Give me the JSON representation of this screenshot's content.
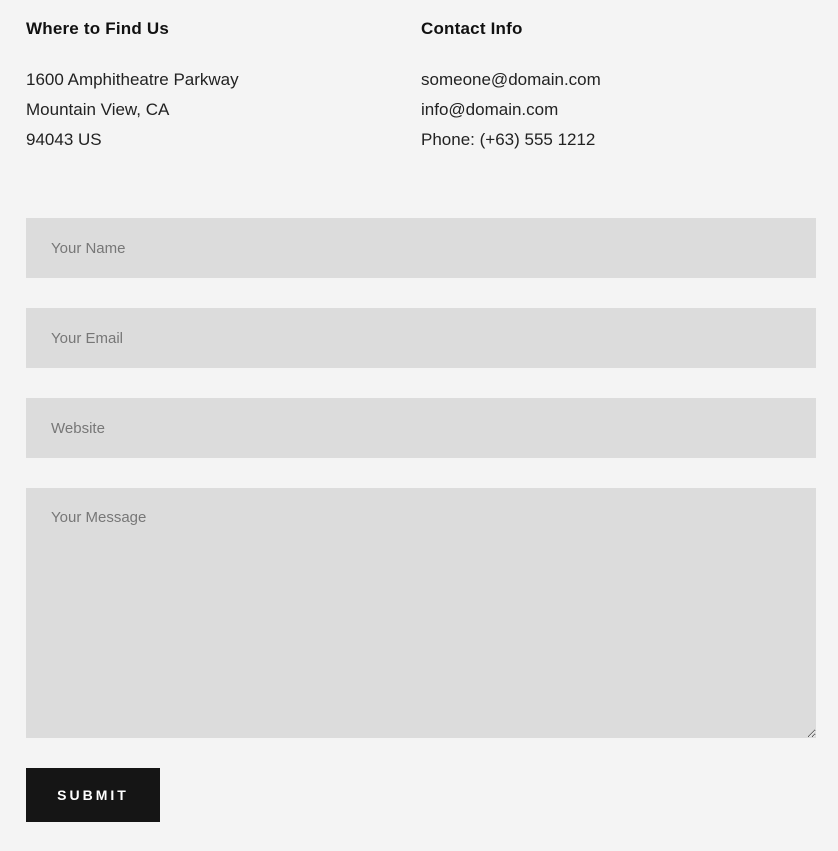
{
  "where": {
    "heading": "Where to Find Us",
    "lines": [
      "1600 Amphitheatre Parkway",
      "Mountain View, CA",
      "94043 US"
    ]
  },
  "contact": {
    "heading": "Contact Info",
    "lines": [
      "someone@domain.com",
      "info@domain.com",
      "Phone: (+63) 555 1212"
    ]
  },
  "form": {
    "name_placeholder": "Your Name",
    "email_placeholder": "Your Email",
    "website_placeholder": "Website",
    "message_placeholder": "Your Message",
    "submit_label": "SUBMIT"
  }
}
